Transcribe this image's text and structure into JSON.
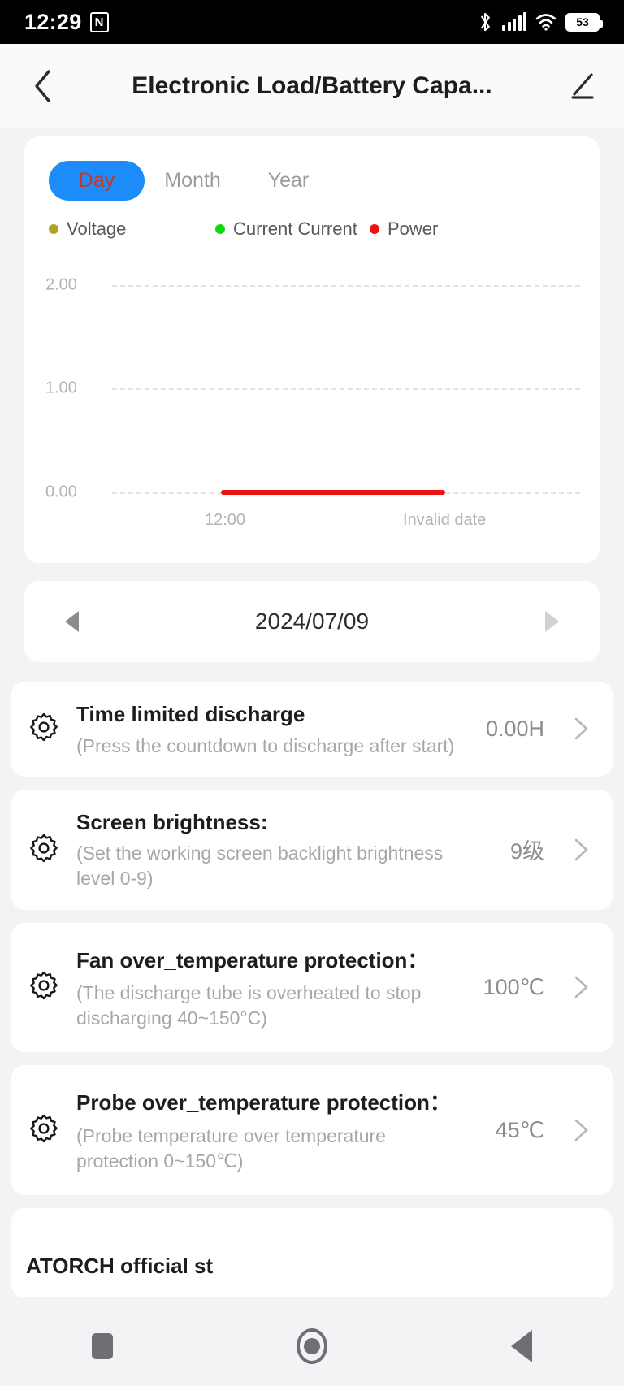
{
  "status_bar": {
    "time": "12:29",
    "nfc_label": "N",
    "battery_percent": "53",
    "icons": [
      "nfc-icon",
      "bluetooth-icon",
      "cellular-signal-icon",
      "wifi-icon",
      "battery-icon"
    ]
  },
  "app_bar": {
    "back_icon": "chevron-left-icon",
    "title": "Electronic Load/Battery Capa...",
    "edit_icon": "pencil-icon"
  },
  "chart_card": {
    "tabs": [
      {
        "label": "Day",
        "active": true
      },
      {
        "label": "Month",
        "active": false
      },
      {
        "label": "Year",
        "active": false
      }
    ],
    "legend": [
      {
        "label": "Voltage",
        "color": "#b0a326"
      },
      {
        "label": "Current Current",
        "color": "#0ad80a"
      },
      {
        "label": "Power",
        "color": "#ee1111"
      }
    ]
  },
  "chart_data": {
    "type": "line",
    "title": "",
    "xlabel": "",
    "ylabel": "",
    "ylim": [
      0,
      2.2
    ],
    "yticks": [
      "0.00",
      "1.00",
      "2.00"
    ],
    "ytick_values": [
      0,
      1,
      2
    ],
    "xticks": [
      "12:00",
      "Invalid date"
    ],
    "grid": true,
    "grid_style": "dotted",
    "legend_position": "top",
    "series": [
      {
        "name": "Voltage",
        "color": "#b0a326",
        "values": []
      },
      {
        "name": "Current Current",
        "color": "#0ad80a",
        "values": []
      },
      {
        "name": "Power",
        "color": "#ee1111",
        "values": [
          0,
          0
        ],
        "x_start_pct": 22,
        "x_end_pct": 73
      }
    ]
  },
  "date_nav": {
    "prev_icon": "triangle-left-icon",
    "date": "2024/07/09",
    "next_icon": "triangle-right-icon"
  },
  "settings": [
    {
      "icon": "gear-icon",
      "title": "Time limited discharge",
      "subtitle": "(Press the countdown to discharge after start)",
      "value": "0.00H",
      "chevron": "chevron-right-icon"
    },
    {
      "icon": "gear-icon",
      "title": "Screen brightness:",
      "subtitle": "(Set the working screen backlight brightness level 0-9)",
      "value": "9级",
      "chevron": "chevron-right-icon"
    },
    {
      "icon": "gear-icon",
      "title": "Fan over_temperature protection：",
      "subtitle": "(The discharge tube is overheated to stop discharging 40~150°C)",
      "value": "100℃",
      "chevron": "chevron-right-icon"
    },
    {
      "icon": "gear-icon",
      "title": "Probe over_temperature protection：",
      "subtitle": "(Probe temperature over temperature protection 0~150℃)",
      "value": "45℃",
      "chevron": "chevron-right-icon"
    }
  ],
  "partial_card": {
    "title": "ATORCH official st"
  },
  "nav_bar": {
    "recents_icon": "square-icon",
    "home_icon": "circle-icon",
    "back_icon": "triangle-back-icon"
  }
}
